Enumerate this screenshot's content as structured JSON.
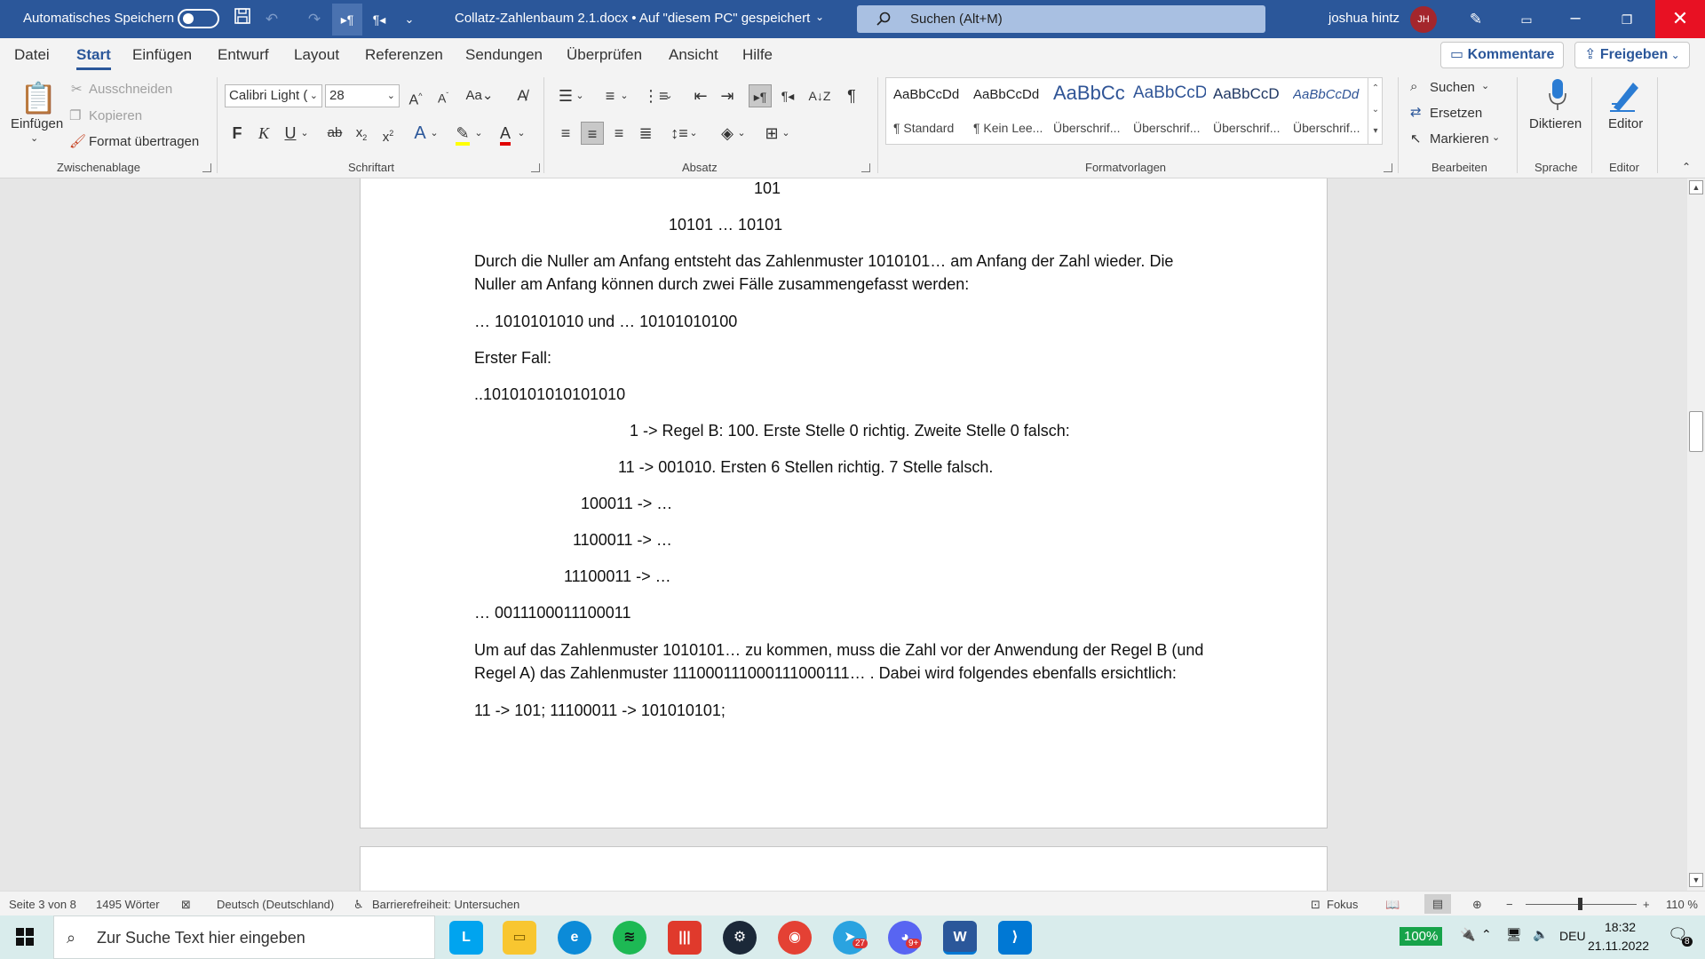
{
  "titlebar": {
    "autosave_label": "Automatisches Speichern",
    "doc_title": "Collatz-Zahlenbaum 2.1.docx  •  Auf \"diesem PC\" gespeichert",
    "search_placeholder": "Suchen (Alt+M)",
    "user_name": "joshua hintz",
    "user_initials": "JH",
    "color": "#2b579a"
  },
  "menu": {
    "tabs": [
      "Datei",
      "Start",
      "Einfügen",
      "Entwurf",
      "Layout",
      "Referenzen",
      "Sendungen",
      "Überprüfen",
      "Ansicht",
      "Hilfe"
    ],
    "active_tab": "Start",
    "comments_label": "Kommentare",
    "share_label": "Freigeben"
  },
  "ribbon": {
    "clipboard": {
      "paste_label": "Einfügen",
      "cut_label": "Ausschneiden",
      "copy_label": "Kopieren",
      "format_painter_label": "Format übertragen",
      "group_label": "Zwischenablage"
    },
    "font": {
      "font_name": "Calibri Light (",
      "font_size": "28",
      "group_label": "Schriftart"
    },
    "paragraph": {
      "group_label": "Absatz"
    },
    "styles": {
      "items": [
        {
          "preview": "AaBbCcDd",
          "name": "¶ Standard"
        },
        {
          "preview": "AaBbCcDd",
          "name": "¶ Kein Lee..."
        },
        {
          "preview": "AaBbCc",
          "name": "Überschrif..."
        },
        {
          "preview": "AaBbCcD",
          "name": "Überschrif..."
        },
        {
          "preview": "AaBbCcD",
          "name": "Überschrif..."
        },
        {
          "preview": "AaBbCcDd",
          "name": "Überschrif..."
        }
      ],
      "group_label": "Formatvorlagen"
    },
    "editing": {
      "find_label": "Suchen",
      "replace_label": "Ersetzen",
      "select_label": "Markieren",
      "group_label": "Bearbeiten"
    },
    "voice": {
      "dictate_label": "Diktieren",
      "group_label": "Sprache"
    },
    "editor": {
      "editor_label": "Editor",
      "group_label": "Editor"
    }
  },
  "document": {
    "lines": [
      "101",
      "10101 …  10101",
      "Durch die Nuller am Anfang entsteht das Zahlenmuster 1010101… am Anfang der Zahl wieder. Die",
      "Nuller am Anfang können durch zwei Fälle zusammengefasst werden:",
      "… 1010101010 und … 10101010100",
      "Erster Fall:",
      "..1010101010101010",
      "1 -> Regel B: 100. Erste Stelle 0 richtig. Zweite Stelle 0 falsch:",
      "11 -> 001010. Ersten 6 Stellen richtig. 7 Stelle falsch.",
      "100011 -> …",
      "1100011 -> …",
      "11100011 -> …",
      "… 0011100011100011",
      "Um auf das Zahlenmuster 1010101… zu kommen, muss die Zahl vor der Anwendung der Regel B (und",
      "Regel A) das Zahlenmuster 111000111000111000111… . Dabei wird folgendes ebenfalls ersichtlich:",
      "11 -> 101; 11100011 -> 101010101;"
    ]
  },
  "statusbar": {
    "page": "Seite 3 von 8",
    "words": "1495 Wörter",
    "language": "Deutsch (Deutschland)",
    "accessibility": "Barrierefreiheit: Untersuchen",
    "focus": "Fokus",
    "zoom": "110 %"
  },
  "taskbar": {
    "search_placeholder": "Zur Suche Text hier eingeben",
    "battery": "100%",
    "language": "DEU",
    "time": "18:32",
    "date": "21.11.2022",
    "notification_count": "8",
    "telegram_badge": "27",
    "discord_badge": "9+"
  }
}
